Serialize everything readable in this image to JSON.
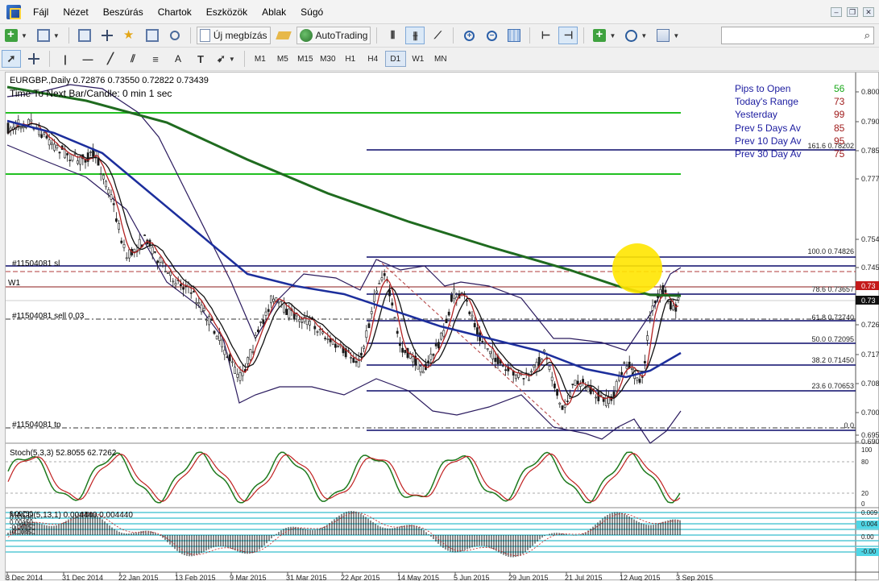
{
  "menu": {
    "items": [
      "Fájl",
      "Nézet",
      "Beszúrás",
      "Chartok",
      "Eszközök",
      "Ablak",
      "Súgó"
    ]
  },
  "toolbar1": {
    "new_order_label": "Új megbízás",
    "autotrading_label": "AutoTrading"
  },
  "toolbar2": {
    "timeframes": [
      "M1",
      "M5",
      "M15",
      "M30",
      "H1",
      "H4",
      "D1",
      "W1",
      "MN"
    ],
    "active_timeframe": "D1",
    "text_tool": "A"
  },
  "chart": {
    "header": "EURGBP.,Daily  0.72876 0.73550 0.72822 0.73439",
    "timer": "Time To Next Bar/Candle: 0 min 1 sec",
    "labels": {
      "sl": "#11504081 sl",
      "w1": "W1",
      "sell": "#11504081 sell 0.03",
      "tp": "#11504081 tp"
    },
    "fib_levels": [
      {
        "label": "100.0 0.74826",
        "price": 0.74826
      },
      {
        "label": "78.6 0.73657",
        "price": 0.73657
      },
      {
        "label": "61.8 0.72740",
        "price": 0.7274
      },
      {
        "label": "50.0 0.72095",
        "price": 0.72095
      },
      {
        "label": "38.2 0.71450",
        "price": 0.7145
      },
      {
        "label": "23.6 0.70653",
        "price": 0.70653
      },
      {
        "label": "0.0",
        "price": 0.69362
      },
      {
        "label": "161.6 0.78202",
        "price": 0.78202
      }
    ],
    "price_axis": [
      "0.800",
      "0.790",
      "0.785",
      "0.777",
      "0.754",
      "0.745",
      "0.726",
      "0.717",
      "0.708",
      "0.700",
      "0.695",
      "0.690"
    ],
    "price_tags": {
      "red": "0.73",
      "black": "0.73"
    },
    "time_axis": [
      "8 Dec 2014",
      "31 Dec 2014",
      "22 Jan 2015",
      "13 Feb 2015",
      "9 Mar 2015",
      "31 Mar 2015",
      "22 Apr 2015",
      "14 May 2015",
      "5 Jun 2015",
      "29 Jun 2015",
      "21 Jul 2015",
      "12 Aug 2015",
      "3 Sep 2015"
    ]
  },
  "pips_panel": {
    "rows": [
      {
        "label": "Pips to Open",
        "value": "56",
        "color": "#1aa81a"
      },
      {
        "label": "Today's Range",
        "value": "73",
        "color": "#a01c1c"
      },
      {
        "label": "Yesterday",
        "value": "99",
        "color": "#a01c1c"
      },
      {
        "label": "Prev 5 Days Av",
        "value": "85",
        "color": "#a01c1c"
      },
      {
        "label": "Prev 10 Day Av",
        "value": "95",
        "color": "#a01c1c"
      },
      {
        "label": "Prev 30 Day Av",
        "value": "75",
        "color": "#a01c1c"
      }
    ]
  },
  "stoch": {
    "label": "Stoch(5,3,3) 52.8055 62.7262",
    "axis": [
      "100",
      "80",
      "20",
      "0"
    ]
  },
  "macd": {
    "label": "MACD(5,13,1) 0.004440 0.004440",
    "axis": [
      "0.009",
      "0.004",
      "0.00",
      "-0.00"
    ],
    "left_levels": [
      "0.00750",
      "0.00450",
      "0.00150",
      "-0.00150",
      "-0.00450"
    ]
  },
  "colors": {
    "ma_green": "#1f6b1f",
    "ma_blue": "#1c2e9c",
    "bands": "#2a1a5e",
    "candle": "#1a1a1a",
    "ma_red": "#b22222",
    "level_green": "#22c022",
    "fib_navy": "#0a0a6a",
    "highlight": "#ffe600"
  }
}
